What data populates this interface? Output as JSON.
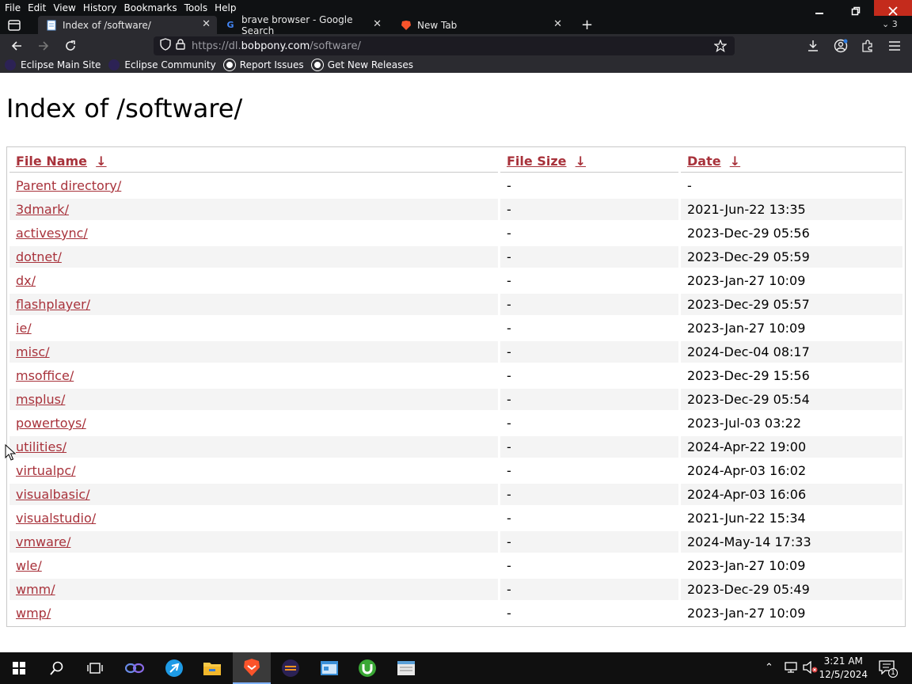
{
  "menu": {
    "items": [
      "File",
      "Edit",
      "View",
      "History",
      "Bookmarks",
      "Tools",
      "Help"
    ]
  },
  "window": {
    "tab_count": "3"
  },
  "tabs": [
    {
      "title": "Index of /software/",
      "active": true,
      "icon": "page-icon"
    },
    {
      "title": "brave browser - Google Search",
      "active": false,
      "icon": "google-icon"
    },
    {
      "title": "New Tab",
      "active": false,
      "icon": "brave-lion-icon"
    }
  ],
  "address": {
    "prefix": "https://dl.",
    "host": "bobpony.com",
    "path": "/software/"
  },
  "bookmarks": [
    {
      "label": "Eclipse Main Site",
      "icon": "eclipse-icon"
    },
    {
      "label": "Eclipse Community",
      "icon": "eclipse-icon"
    },
    {
      "label": "Report Issues",
      "icon": "github-icon"
    },
    {
      "label": "Get New Releases",
      "icon": "github-icon"
    }
  ],
  "page": {
    "title": "Index of /software/",
    "headers": {
      "name": "File Name",
      "size": "File Size",
      "date": "Date",
      "sort_arrow": "↓"
    },
    "rows": [
      {
        "name": "Parent directory/",
        "size": "-",
        "date": "-"
      },
      {
        "name": "3dmark/",
        "size": "-",
        "date": "2021-Jun-22 13:35"
      },
      {
        "name": "activesync/",
        "size": "-",
        "date": "2023-Dec-29 05:56"
      },
      {
        "name": "dotnet/",
        "size": "-",
        "date": "2023-Dec-29 05:59"
      },
      {
        "name": "dx/",
        "size": "-",
        "date": "2023-Jan-27 10:09"
      },
      {
        "name": "flashplayer/",
        "size": "-",
        "date": "2023-Dec-29 05:57"
      },
      {
        "name": "ie/",
        "size": "-",
        "date": "2023-Jan-27 10:09"
      },
      {
        "name": "misc/",
        "size": "-",
        "date": "2024-Dec-04 08:17"
      },
      {
        "name": "msoffice/",
        "size": "-",
        "date": "2023-Dec-29 15:56"
      },
      {
        "name": "msplus/",
        "size": "-",
        "date": "2023-Dec-29 05:54"
      },
      {
        "name": "powertoys/",
        "size": "-",
        "date": "2023-Jul-03 03:22"
      },
      {
        "name": "utilities/",
        "size": "-",
        "date": "2024-Apr-22 19:00"
      },
      {
        "name": "virtualpc/",
        "size": "-",
        "date": "2024-Apr-03 16:02"
      },
      {
        "name": "visualbasic/",
        "size": "-",
        "date": "2024-Apr-03 16:06"
      },
      {
        "name": "visualstudio/",
        "size": "-",
        "date": "2021-Jun-22 15:34"
      },
      {
        "name": "vmware/",
        "size": "-",
        "date": "2024-May-14 17:33"
      },
      {
        "name": "wle/",
        "size": "-",
        "date": "2023-Jan-27 10:09"
      },
      {
        "name": "wmm/",
        "size": "-",
        "date": "2023-Dec-29 05:49"
      },
      {
        "name": "wmp/",
        "size": "-",
        "date": "2023-Jan-27 10:09"
      }
    ]
  },
  "taskbar": {
    "time": "3:21 AM",
    "date": "12/5/2024",
    "notification_count": "1",
    "apps": [
      "start-icon",
      "search-icon",
      "task-view-icon",
      "app-icon",
      "browser-icon",
      "file-explorer-icon",
      "brave-icon",
      "eclipse-icon",
      "app-window-icon",
      "utorrent-icon",
      "notepad-icon"
    ]
  },
  "colors": {
    "link": "#a8323b",
    "chrome_dark": "#2b2b30",
    "row_alt": "#f4f4f4"
  }
}
